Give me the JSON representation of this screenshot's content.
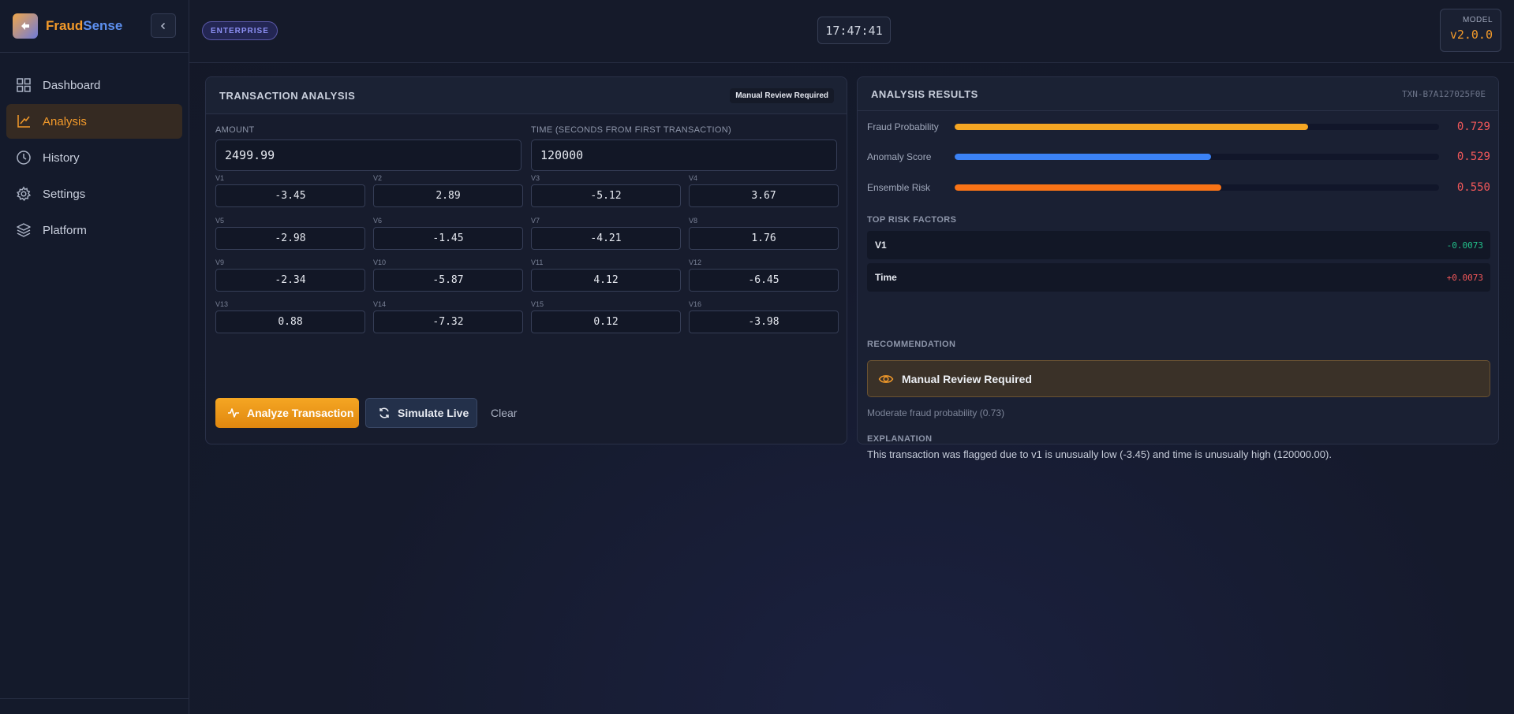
{
  "brand": {
    "part1": "Fraud",
    "part2": "Sense"
  },
  "nav": [
    {
      "label": "Dashboard",
      "icon": "grid-icon"
    },
    {
      "label": "Analysis",
      "icon": "chart-line-icon"
    },
    {
      "label": "History",
      "icon": "clock-icon"
    },
    {
      "label": "Settings",
      "icon": "gear-icon"
    },
    {
      "label": "Platform",
      "icon": "layers-icon"
    }
  ],
  "header": {
    "badge": "ENTERPRISE",
    "clock": "17:47:41",
    "model_label": "MODEL",
    "model_version": "v2.0.0"
  },
  "analysis": {
    "title": "TRANSACTION ANALYSIS",
    "status_chip": "Manual Review Required",
    "amount_label": "AMOUNT",
    "amount_value": "2499.99",
    "time_label": "TIME (SECONDS FROM FIRST TRANSACTION)",
    "time_value": "120000",
    "features": [
      {
        "label": "V1",
        "value": "-3.45"
      },
      {
        "label": "V2",
        "value": "2.89"
      },
      {
        "label": "V3",
        "value": "-5.12"
      },
      {
        "label": "V4",
        "value": "3.67"
      },
      {
        "label": "V5",
        "value": "-2.98"
      },
      {
        "label": "V6",
        "value": "-1.45"
      },
      {
        "label": "V7",
        "value": "-4.21"
      },
      {
        "label": "V8",
        "value": "1.76"
      },
      {
        "label": "V9",
        "value": "-2.34"
      },
      {
        "label": "V10",
        "value": "-5.87"
      },
      {
        "label": "V11",
        "value": "4.12"
      },
      {
        "label": "V12",
        "value": "-6.45"
      },
      {
        "label": "V13",
        "value": "0.88"
      },
      {
        "label": "V14",
        "value": "-7.32"
      },
      {
        "label": "V15",
        "value": "0.12"
      },
      {
        "label": "V16",
        "value": "-3.98"
      }
    ],
    "analyze_label": "Analyze Transaction",
    "simulate_label": "Simulate Live",
    "clear_label": "Clear"
  },
  "results": {
    "title": "ANALYSIS RESULTS",
    "txn_id": "TXN-B7A127025F0E",
    "metrics": [
      {
        "name": "Fraud Probability",
        "value": "0.729",
        "fraction": 0.729,
        "color": "#f5a623"
      },
      {
        "name": "Anomaly Score",
        "value": "0.529",
        "fraction": 0.529,
        "color": "#3b82f6"
      },
      {
        "name": "Ensemble Risk",
        "value": "0.550",
        "fraction": 0.55,
        "color": "#f97316"
      }
    ],
    "top_factors_label": "TOP RISK FACTORS",
    "factors": [
      {
        "name": "V1",
        "value": "-0.0073",
        "color": "#22c08a"
      },
      {
        "name": "Time",
        "value": "+0.0073",
        "color": "#f4585a"
      }
    ],
    "recommendation_label": "RECOMMENDATION",
    "recommendation": "Manual Review Required",
    "recommendation_sub": "Moderate fraud probability (0.73)",
    "explanation_label": "EXPLANATION",
    "explanation": "This transaction was flagged due to v1 is unusually low (-3.45) and time is unusually high (120000.00)."
  }
}
